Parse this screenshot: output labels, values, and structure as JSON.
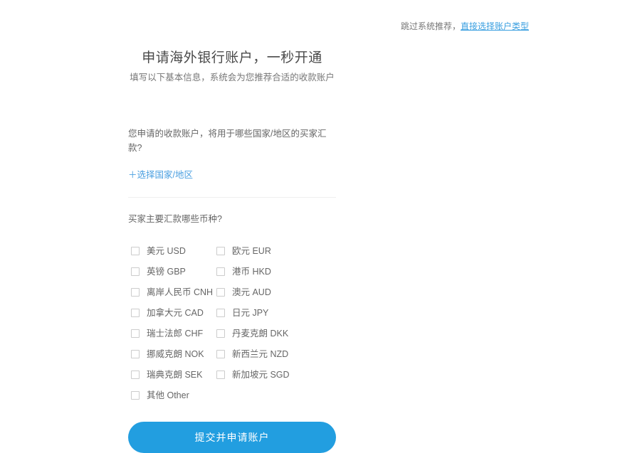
{
  "topbar": {
    "skip_text": "跳过系统推荐，",
    "skip_link_label": "直接选择账户类型"
  },
  "header": {
    "title": "申请海外银行账户，一秒开通",
    "subtitle": "填写以下基本信息，系统会为您推荐合适的收款账户"
  },
  "country_section": {
    "question": "您申请的收款账户，将用于哪些国家/地区的买家汇款?",
    "add_link_label": "＋选择国家/地区"
  },
  "currency_section": {
    "question": "买家主要汇款哪些币种?",
    "options": [
      {
        "label": "美元 USD",
        "checked": false
      },
      {
        "label": "欧元 EUR",
        "checked": false
      },
      {
        "label": "英镑 GBP",
        "checked": false
      },
      {
        "label": "港币 HKD",
        "checked": false
      },
      {
        "label": "离岸人民币 CNH",
        "checked": false
      },
      {
        "label": "澳元 AUD",
        "checked": false
      },
      {
        "label": "加拿大元 CAD",
        "checked": false
      },
      {
        "label": "日元 JPY",
        "checked": false
      },
      {
        "label": "瑞士法郎 CHF",
        "checked": false
      },
      {
        "label": "丹麦克朗 DKK",
        "checked": false
      },
      {
        "label": "挪威克朗 NOK",
        "checked": false
      },
      {
        "label": "新西兰元 NZD",
        "checked": false
      },
      {
        "label": "瑞典克朗 SEK",
        "checked": false
      },
      {
        "label": "新加坡元 SGD",
        "checked": false
      },
      {
        "label": "其他 Other",
        "checked": false
      }
    ]
  },
  "submit": {
    "label": "提交并申请账户"
  },
  "colors": {
    "accent": "#229ee0",
    "link": "#4a9fe0",
    "text": "#666666",
    "title": "#4a4a4a",
    "divider": "#eeeeee",
    "checkbox_border": "#cccccc",
    "background": "#ffffff"
  }
}
